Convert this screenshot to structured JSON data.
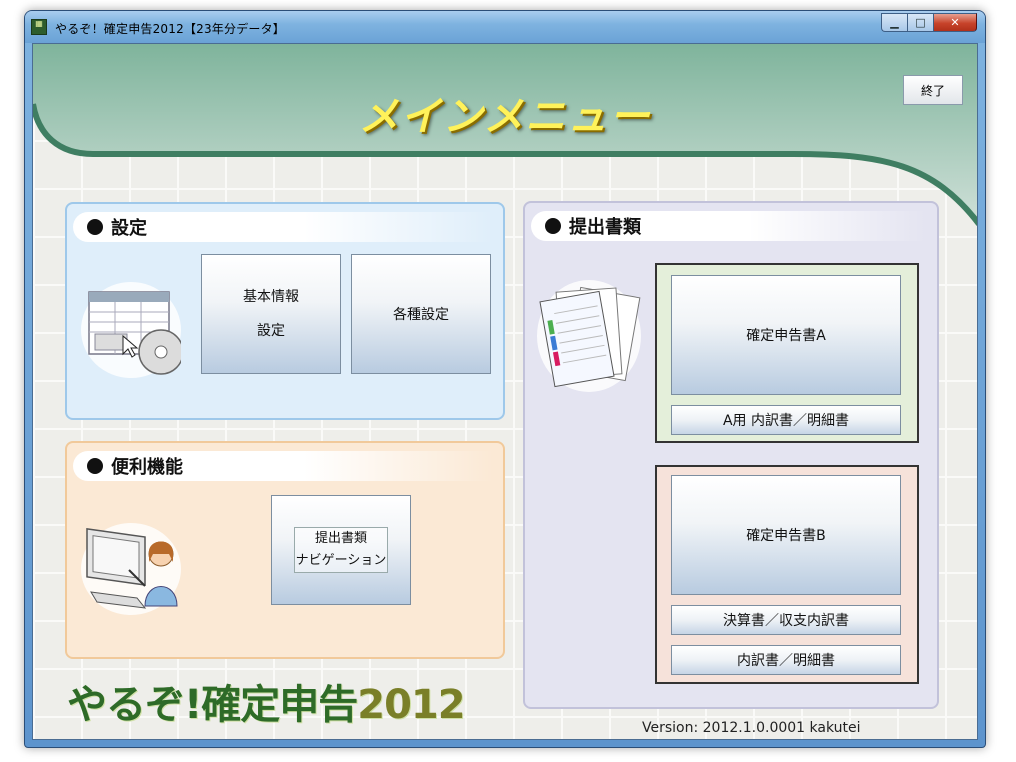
{
  "window": {
    "title": "やるぞ！確定申告2012【23年分データ】",
    "icon": "app-icon",
    "minimize_label": "▁",
    "maximize_label": "□",
    "close_label": "✕"
  },
  "header": {
    "title": "メインメニュー",
    "exit_label": "終了"
  },
  "settings": {
    "heading": "設定",
    "basic_info_line1": "基本情報",
    "basic_info_line2": "設定",
    "various_settings": "各種設定"
  },
  "tools": {
    "heading": "便利機能",
    "nav_line1": "提出書類",
    "nav_line2": "ナビゲーション"
  },
  "documents": {
    "heading": "提出書類",
    "return_a": "確定申告書A",
    "return_a_details": "A用 内訳書／明細書",
    "return_b": "確定申告書B",
    "financial_statements": "決算書／収支内訳書",
    "details_b": "内訳書／明細書"
  },
  "footer": {
    "logo_text": "やるぞ!確定申告",
    "logo_year": "2012",
    "version": "Version: 2012.1.0.0001 kakutei"
  },
  "colors": {
    "banner": "#6fa58a",
    "title_yellow": "#fff25a",
    "logo_green": "#2e6b28"
  }
}
